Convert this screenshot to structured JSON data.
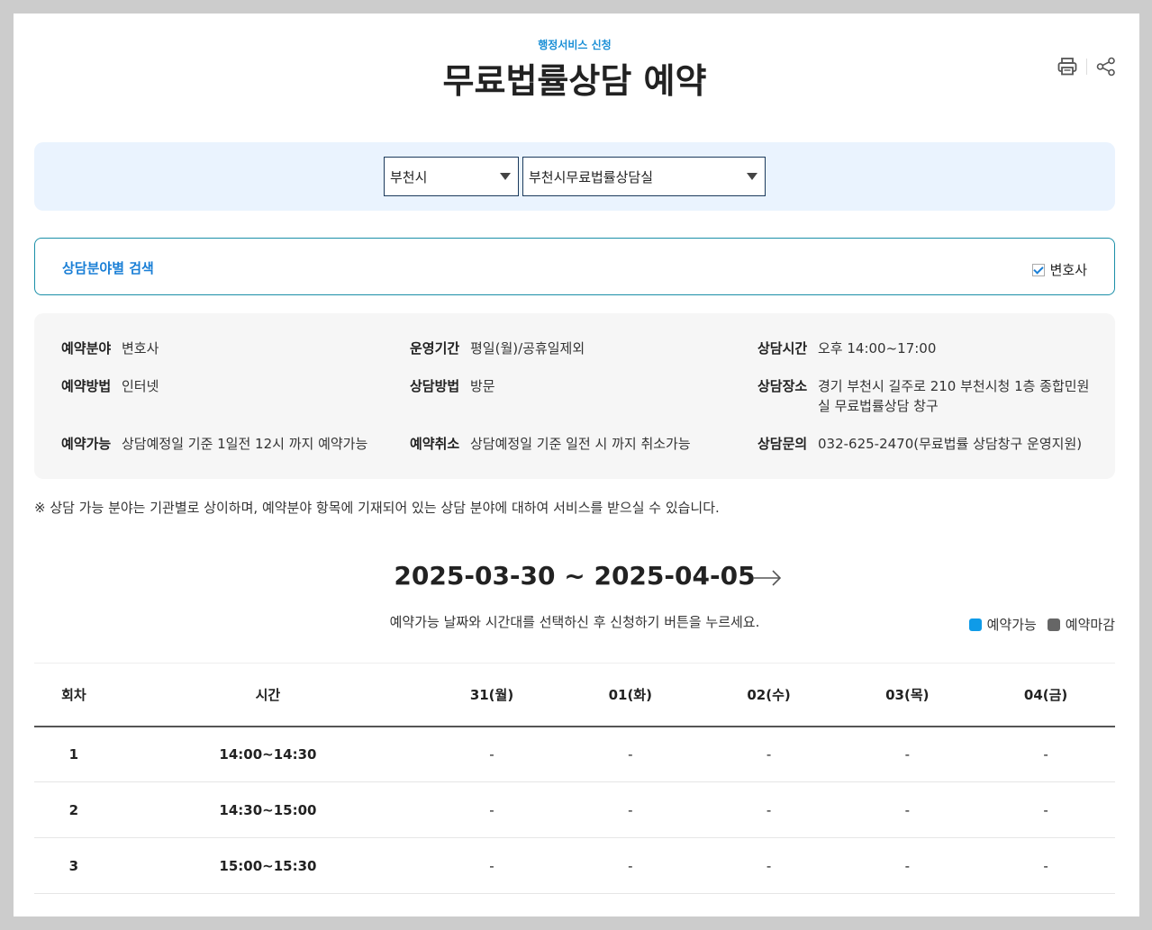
{
  "header": {
    "subtitle": "행정서비스 신청",
    "title": "무료법률상담 예약",
    "icons": [
      "printer-icon",
      "share-icon"
    ]
  },
  "selects": {
    "city": "부천시",
    "office": "부천시무료법률상담실"
  },
  "search": {
    "label": "상담분야별 검색",
    "checkbox_label": "변호사",
    "checked": true
  },
  "info": {
    "field_label": "예약분야",
    "field_value": "변호사",
    "period_label": "운영기간",
    "period_value": "평일(월)/공휴일제외",
    "time_label": "상담시간",
    "time_value": "오후 14:00~17:00",
    "method_label": "예약방법",
    "method_value": "인터넷",
    "consult_method_label": "상담방법",
    "consult_method_value": "방문",
    "place_label": "상담장소",
    "place_value": "경기 부천시 길주로 210  부천시청 1층 종합민원실 무료법률상담 창구",
    "avail_label": "예약가능",
    "avail_value": "상담예정일 기준 1일전 12시 까지 예약가능",
    "cancel_label": "예약취소",
    "cancel_value": "상담예정일 기준 일전 시 까지 취소가능",
    "contact_label": "상담문의",
    "contact_value": "032-625-2470(무료법률 상담창구 운영지원)"
  },
  "notice": "※ 상담 가능 분야는 기관별로 상이하며, 예약분야 항목에 기재되어 있는 상담 분야에 대하여 서비스를 받으실 수 있습니다.",
  "calendar": {
    "date_range": "2025-03-30 ~ 2025-04-05",
    "guide": "예약가능 날짜와 시간대를 선택하신 후 신청하기 버튼을 누르세요.",
    "legend": {
      "available": "예약가능",
      "available_color": "#0f9be8",
      "closed": "예약마감",
      "closed_color": "#666666"
    },
    "headers": [
      "회차",
      "시간",
      "31(월)",
      "01(화)",
      "02(수)",
      "03(목)",
      "04(금)"
    ],
    "rows": [
      {
        "no": "1",
        "time": "14:00~14:30",
        "slots": [
          "-",
          "-",
          "-",
          "-",
          "-"
        ]
      },
      {
        "no": "2",
        "time": "14:30~15:00",
        "slots": [
          "-",
          "-",
          "-",
          "-",
          "-"
        ]
      },
      {
        "no": "3",
        "time": "15:00~15:30",
        "slots": [
          "-",
          "-",
          "-",
          "-",
          "-"
        ]
      }
    ]
  }
}
